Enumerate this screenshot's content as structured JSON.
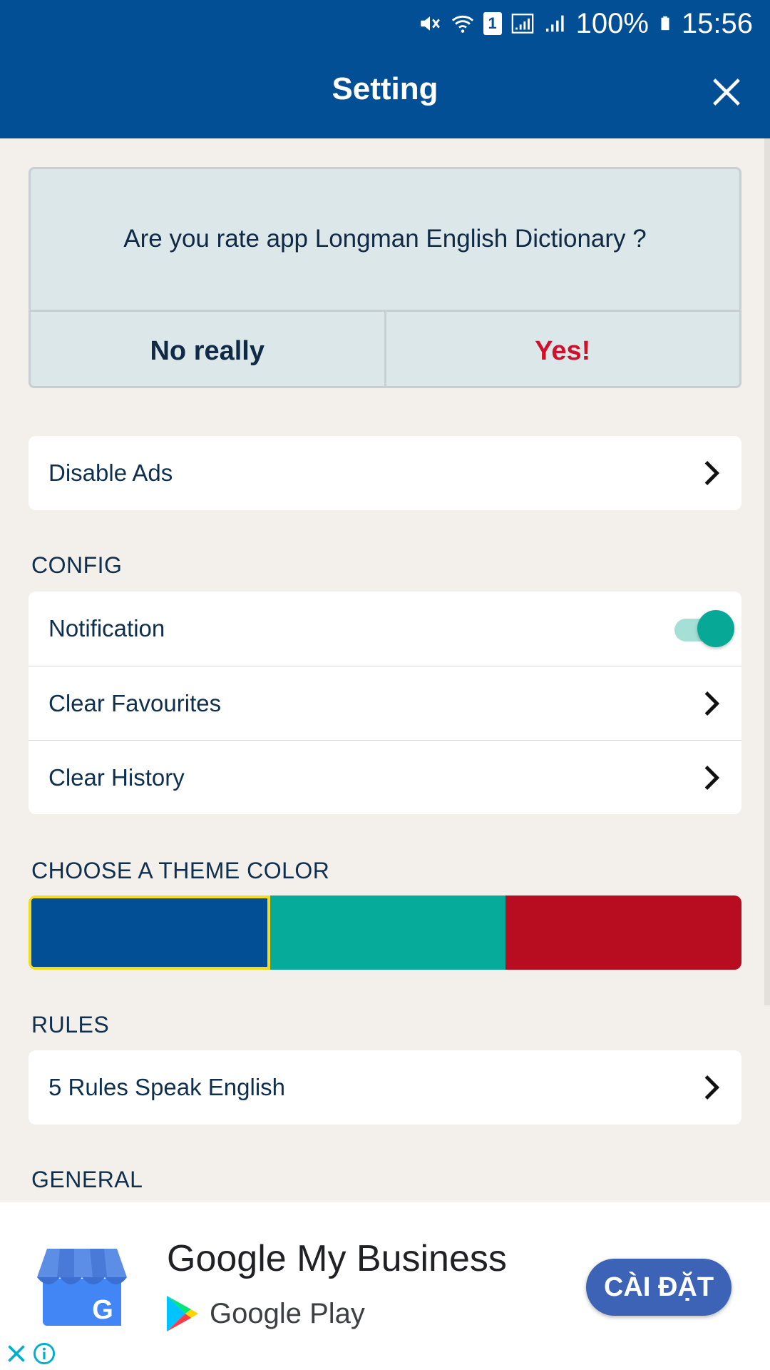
{
  "status_bar": {
    "icons": [
      "mute-icon",
      "wifi-icon",
      "sim-icon",
      "signal-icon",
      "signal-icon",
      "battery-icon"
    ],
    "sim_slot": "1",
    "battery": "100%",
    "time": "15:56"
  },
  "app_bar": {
    "title": "Setting",
    "close_icon": "close-icon"
  },
  "rate_dialog": {
    "question": "Are you rate app Longman English Dictionary ?",
    "no_label": "No really",
    "yes_label": "Yes!",
    "yes_color": "#d0112b"
  },
  "disable_ads": {
    "label": "Disable Ads"
  },
  "config": {
    "header": "CONFIG",
    "items": [
      {
        "label": "Notification",
        "type": "toggle",
        "on": true
      },
      {
        "label": "Clear Favourites",
        "type": "link"
      },
      {
        "label": "Clear History",
        "type": "link"
      }
    ]
  },
  "theme": {
    "header": "CHOOSE A THEME COLOR",
    "colors": [
      "#034f95",
      "#07ab99",
      "#b80d20"
    ],
    "selected_index": 0,
    "selected_border": "#f3db1d"
  },
  "rules": {
    "header": "RULES",
    "items": [
      {
        "label": "5 Rules Speak English"
      }
    ]
  },
  "general": {
    "header": "GENERAL"
  },
  "ad": {
    "title": "Google My Business",
    "store_name": "Google Play",
    "cta": "CÀI ĐẶT",
    "cta_color": "#3c63b5"
  },
  "accent": "#034f95"
}
